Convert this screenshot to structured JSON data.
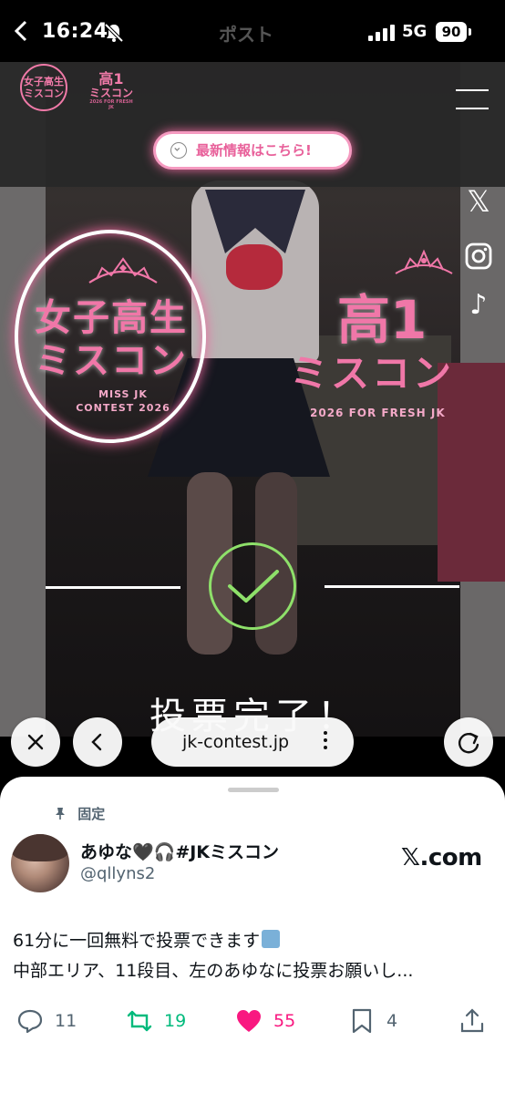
{
  "status_bar": {
    "time": "16:24",
    "page_title": "ポスト",
    "network": "5G",
    "battery": "90"
  },
  "website": {
    "header_logo_circle": "女子高生\nミスコン",
    "header_logo_k1_a": "高1",
    "header_logo_k1_b": "ミスコン",
    "header_logo_k1_c": "2026 FOR FRESH JK",
    "info_button_label": "最新情報はこちら!",
    "hero_title_line1": "女子高生",
    "hero_title_line2": "ミスコン",
    "hero_sub_line1": "MISS JK",
    "hero_sub_line2": "CONTEST 2026",
    "k1_title": "高1",
    "k1_sub": "ミスコン",
    "k1_en": "2026 FOR FRESH JK",
    "vote_complete": "投票完了！",
    "social": [
      "x-icon",
      "instagram-icon",
      "tiktok-icon"
    ]
  },
  "browser": {
    "url": "jk-contest.jp"
  },
  "tweet": {
    "pinned_label": "固定",
    "author_name": "あゆな🖤🎧#JKミスコン",
    "author_handle": "@qllyns2",
    "source": "𝕏.com",
    "text_line1": "61分に一回無料で投票できます",
    "text_line2": "中部エリア、11段目、左のあゆなに投票お願いし...",
    "replies": "11",
    "reposts": "19",
    "likes": "55",
    "bookmarks": "4"
  },
  "colors": {
    "brand_pink": "#f077a8",
    "check_green": "#8ee06a",
    "repost_green": "#00ba7c",
    "like_pink": "#f91880"
  }
}
